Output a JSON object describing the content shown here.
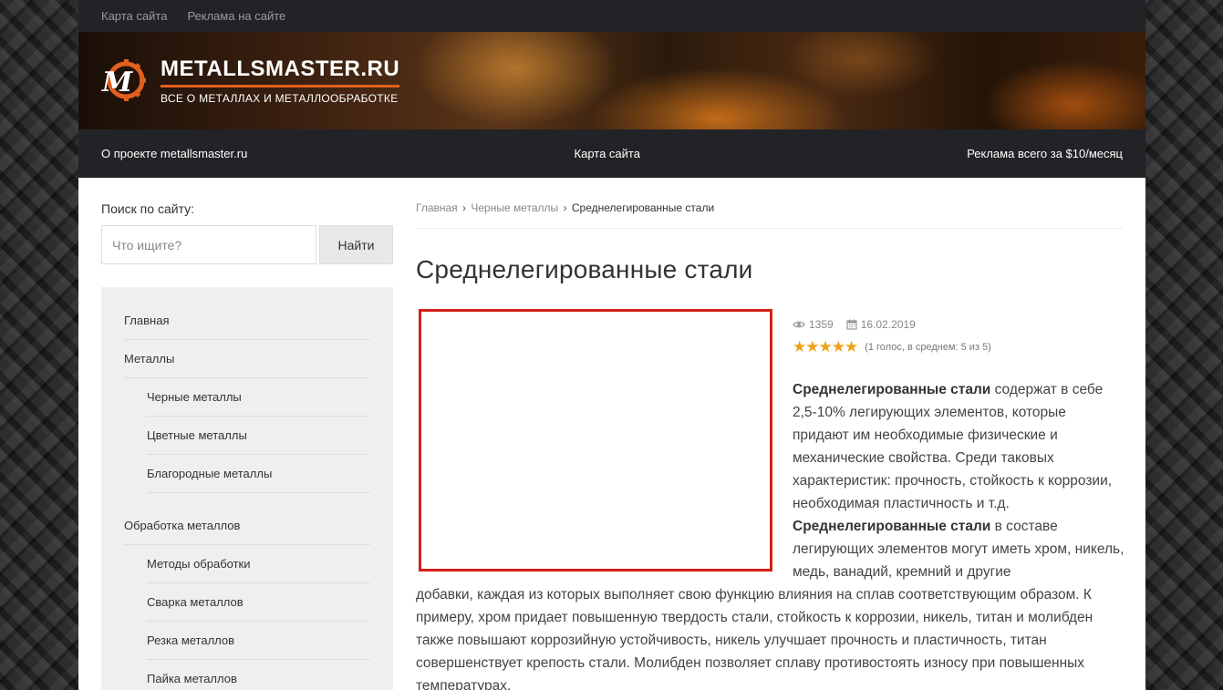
{
  "topbar": {
    "links": [
      "Карта сайта",
      "Реклама на сайте"
    ]
  },
  "header": {
    "logo_letter": "M",
    "site_title": "METALLSMASTER.RU",
    "tagline": "ВСЕ О МЕТАЛЛАХ И МЕТАЛЛООБРАБОТКЕ"
  },
  "mainnav": {
    "left": "О проекте metallsmaster.ru",
    "center": "Карта сайта",
    "right": "Реклама всего за $10/месяц"
  },
  "sidebar": {
    "search_label": "Поиск по сайту:",
    "search_placeholder": "Что ищите?",
    "search_button": "Найти",
    "menu": [
      {
        "label": "Главная",
        "level": 0
      },
      {
        "label": "Металлы",
        "level": 0
      },
      {
        "label": "Черные металлы",
        "level": 1
      },
      {
        "label": "Цветные металлы",
        "level": 1
      },
      {
        "label": "Благородные металлы",
        "level": 1
      },
      {
        "label": "Обработка металлов",
        "level": 0
      },
      {
        "label": "Методы обработки",
        "level": 1
      },
      {
        "label": "Сварка металлов",
        "level": 1
      },
      {
        "label": "Резка металлов",
        "level": 1
      },
      {
        "label": "Пайка металлов",
        "level": 1
      }
    ]
  },
  "breadcrumb": {
    "home": "Главная",
    "section": "Черные металлы",
    "current": "Среднелегированные стали",
    "separator": "›"
  },
  "article": {
    "title": "Среднелегированные стали",
    "views": "1359",
    "date": "16.02.2019",
    "rating_stars": 5,
    "rating_text": "(1 голос, в среднем: 5 из 5)",
    "p1_bold": "Среднелегированные стали",
    "p1_text": " содержат в себе 2,5-10% легирующих элементов, которые придают им необходимые физические и механические свойства. Среди таковых характеристик: прочность, стойкость к коррозии, необходимая пластичность и т.д.",
    "p2_bold": "Среднелегированные стали",
    "p2_text": " в составе легирующих элементов могут иметь хром, никель, медь, ванадий, кремний и другие",
    "p2_cont": "добавки, каждая из которых выполняет свою функцию влияния на сплав соответствующим образом. К примеру, хром придает повышенную твердость стали, стойкость к коррозии, никель, титан и молибден также повышают коррозийную устойчивость, никель улучшает прочность и пластичность, титан совершенствует крепость стали. Молибден позволяет сплаву противостоять износу при повышенных температурах."
  },
  "colors": {
    "accent": "#e2601e",
    "image_border": "#d4201a",
    "star": "#f0a116",
    "dark_bar": "#222326"
  },
  "icons": {
    "views": "eye-icon",
    "date": "calendar-icon",
    "logo": "gear-logo-icon"
  }
}
